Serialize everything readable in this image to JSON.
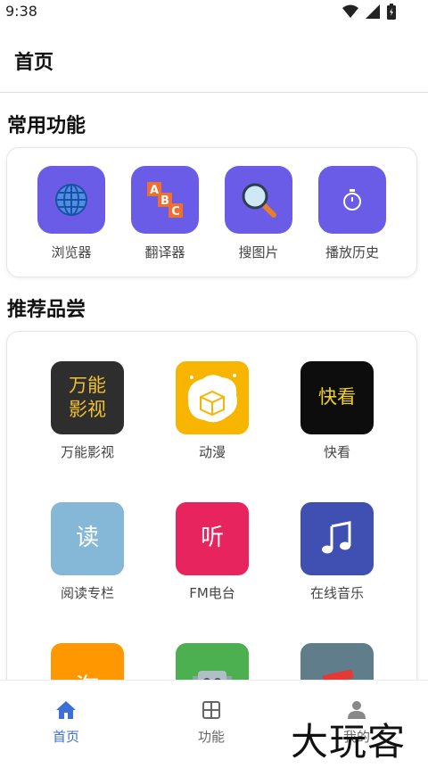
{
  "status_bar": {
    "time": "9:38",
    "icons": [
      "wifi-icon",
      "signal-icon",
      "battery-icon"
    ]
  },
  "header": {
    "title": "首页"
  },
  "common_section": {
    "title": "常用功能",
    "items": [
      {
        "label": "浏览器",
        "icon": "globe-icon"
      },
      {
        "label": "翻译器",
        "icon": "abc-blocks-icon",
        "glyphs": [
          "A",
          "B",
          "C"
        ]
      },
      {
        "label": "搜图片",
        "icon": "magnifier-icon"
      },
      {
        "label": "播放历史",
        "icon": "stopwatch-icon"
      }
    ]
  },
  "recommend_section": {
    "title": "推荐品尝",
    "items": [
      {
        "label": "万能影视",
        "tile_text_1": "万能",
        "tile_text_2": "影视",
        "color": "#2e2e2e",
        "text_color": "#f2c12e"
      },
      {
        "label": "动漫",
        "color": "#f7b500"
      },
      {
        "label": "快看",
        "tile_text_1": "快看",
        "color": "#0d0d0d",
        "text_color": "#f2d21b"
      },
      {
        "label": "阅读专栏",
        "tile_text_1": "读",
        "color": "#85b8d6",
        "text_color": "#ffffff"
      },
      {
        "label": "FM电台",
        "tile_text_1": "听",
        "color": "#e8245f",
        "text_color": "#ffffff"
      },
      {
        "label": "在线音乐",
        "icon": "music-note-icon",
        "color": "#3f4fb2"
      },
      {
        "tile_text_1": "淘",
        "color": "#ff9800",
        "text_color": "#ffffff"
      },
      {
        "icon": "robot-icon",
        "color": "#4caf50"
      },
      {
        "icon": "books-icon",
        "color": "#607d8b"
      }
    ]
  },
  "bottom_nav": {
    "items": [
      {
        "label": "首页",
        "icon": "home-icon",
        "active": true
      },
      {
        "label": "功能",
        "icon": "grid-icon",
        "active": false
      },
      {
        "label": "我的",
        "icon": "person-icon",
        "active": false
      }
    ]
  },
  "watermark": "大玩客",
  "colors": {
    "accent": "#3d6fd9",
    "tile_purple": "#6b5ce7"
  }
}
